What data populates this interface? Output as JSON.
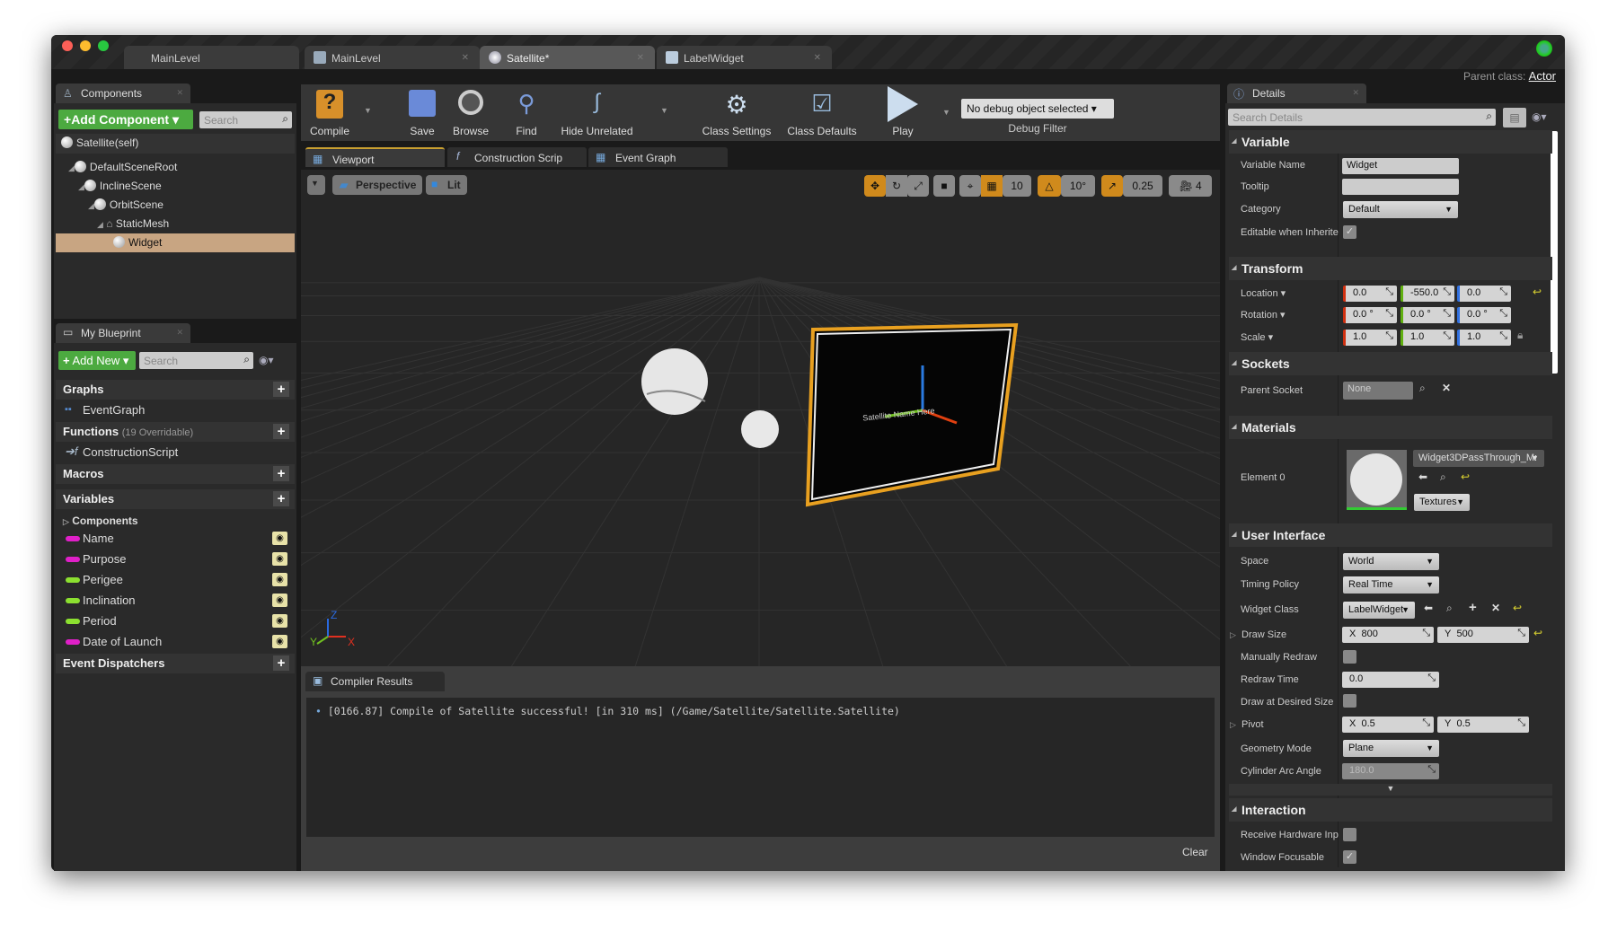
{
  "window": {
    "tabs": [
      {
        "label": "MainLevel"
      },
      {
        "label": "MainLevel"
      },
      {
        "label": "Satellite*"
      },
      {
        "label": "LabelWidget"
      }
    ],
    "parent_class_label": "Parent class:",
    "parent_class": "Actor"
  },
  "components": {
    "tab": "Components",
    "add_label": "Add Component",
    "search_placeholder": "Search",
    "self": "Satellite(self)",
    "tree": [
      {
        "label": "DefaultSceneRoot"
      },
      {
        "label": "InclineScene"
      },
      {
        "label": "OrbitScene"
      },
      {
        "label": "StaticMesh"
      },
      {
        "label": "Widget",
        "selected": true
      }
    ]
  },
  "blueprint": {
    "tab": "My Blueprint",
    "add_label": "Add New",
    "search_placeholder": "Search",
    "graphs": "Graphs",
    "event_graph": "EventGraph",
    "functions": "Functions",
    "functions_note": "(19 Overridable)",
    "construction_script": "ConstructionScript",
    "macros": "Macros",
    "variables": "Variables",
    "components": "Components",
    "vars": [
      {
        "label": "Name",
        "color": "#e020c8"
      },
      {
        "label": "Purpose",
        "color": "#e020c8"
      },
      {
        "label": "Perigee",
        "color": "#8ce030"
      },
      {
        "label": "Inclination",
        "color": "#8ce030"
      },
      {
        "label": "Period",
        "color": "#8ce030"
      },
      {
        "label": "Date of Launch",
        "color": "#e020c8"
      }
    ],
    "event_dispatchers": "Event Dispatchers"
  },
  "toolbar": {
    "compile": "Compile",
    "save": "Save",
    "browse": "Browse",
    "find": "Find",
    "hide_unrelated": "Hide Unrelated",
    "class_settings": "Class Settings",
    "class_defaults": "Class Defaults",
    "play": "Play",
    "debug_select": "No debug object selected",
    "debug_filter": "Debug Filter"
  },
  "doc_tabs": [
    {
      "label": "Viewport"
    },
    {
      "label": "Construction Scrip"
    },
    {
      "label": "Event Graph"
    }
  ],
  "viewport": {
    "perspective": "Perspective",
    "lit": "Lit",
    "grid_snap": "10",
    "rot_snap": "10°",
    "scale_snap": "0.25",
    "camera_speed": "4",
    "widget_text": "Satellite Name Here",
    "axis": {
      "x": "X",
      "y": "Y",
      "z": "Z"
    }
  },
  "compiler": {
    "tab": "Compiler Results",
    "message": "[0166.87] Compile of Satellite successful! [in 310 ms] (/Game/Satellite/Satellite.Satellite)",
    "clear": "Clear"
  },
  "details": {
    "tab": "Details",
    "search_placeholder": "Search Details",
    "variable": {
      "title": "Variable",
      "name_label": "Variable Name",
      "name": "Widget",
      "tooltip_label": "Tooltip",
      "tooltip": "",
      "category_label": "Category",
      "category": "Default",
      "editable_label": "Editable when Inherite",
      "editable": true
    },
    "transform": {
      "title": "Transform",
      "location_label": "Location",
      "location": [
        "0.0",
        "-550.0",
        "0.0"
      ],
      "rotation_label": "Rotation",
      "rotation": [
        "0.0 °",
        "0.0 °",
        "0.0 °"
      ],
      "scale_label": "Scale",
      "scale": [
        "1.0",
        "1.0",
        "1.0"
      ]
    },
    "sockets": {
      "title": "Sockets",
      "parent_label": "Parent Socket",
      "parent": "None"
    },
    "materials": {
      "title": "Materials",
      "element_label": "Element 0",
      "material": "Widget3DPassThrough_M:",
      "textures": "Textures"
    },
    "ui": {
      "title": "User Interface",
      "space_label": "Space",
      "space": "World",
      "timing_label": "Timing Policy",
      "timing": "Real Time",
      "class_label": "Widget Class",
      "class": "LabelWidget",
      "draw_size_label": "Draw Size",
      "draw_x": "800",
      "draw_y": "500",
      "manual_label": "Manually Redraw",
      "manual": false,
      "redraw_label": "Redraw Time",
      "redraw": "0.0",
      "desired_label": "Draw at Desired Size",
      "desired": false,
      "pivot_label": "Pivot",
      "pivot_x": "0.5",
      "pivot_y": "0.5",
      "geometry_label": "Geometry Mode",
      "geometry": "Plane",
      "arc_label": "Cylinder Arc Angle",
      "arc": "180.0",
      "x": "X",
      "y": "Y"
    },
    "interaction": {
      "title": "Interaction",
      "receive_label": "Receive Hardware Inp",
      "receive": false,
      "focusable_label": "Window Focusable",
      "focusable": true
    }
  }
}
